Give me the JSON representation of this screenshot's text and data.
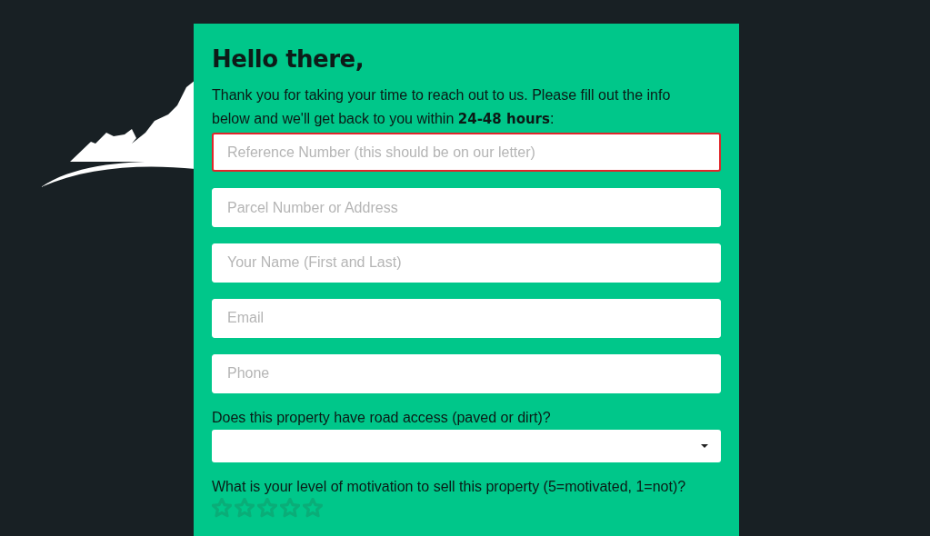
{
  "form": {
    "title": "Hello there,",
    "intro": "Thank you for taking your time to reach out to us. Please fill out the info below and we'll get back to you within **24-48 hours**:",
    "fields": [
      {
        "placeholder": "Reference Number (this should be on our letter)",
        "error": true
      },
      {
        "placeholder": "Parcel Number or Address",
        "error": false
      },
      {
        "placeholder": "Your Name (First and Last)",
        "error": false
      },
      {
        "placeholder": "Email",
        "error": false
      },
      {
        "placeholder": "Phone",
        "error": false
      }
    ],
    "road_access": {
      "label": "Does this property have road access (paved or dirt)?"
    },
    "motivation": {
      "label": "What is your level of motivation to sell this property (5=motivated, 1=not)?",
      "stars": 0
    }
  }
}
